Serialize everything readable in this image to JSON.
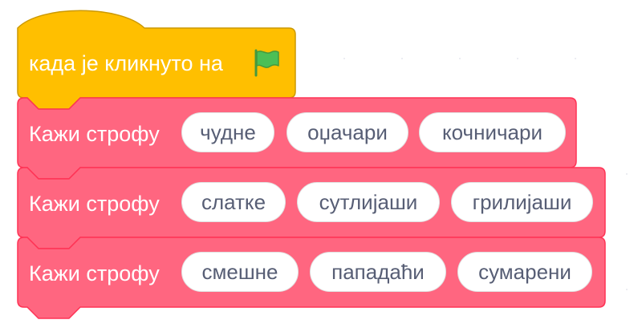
{
  "hat_block": {
    "label": "када је кликнуто на",
    "icon": "green-flag-icon",
    "color": "#ffbf00",
    "border_color": "#cc9900"
  },
  "say_blocks": [
    {
      "label": "Кажи строфу",
      "args": [
        "чудне",
        "оџачари",
        "кочничари"
      ]
    },
    {
      "label": "Кажи строфу",
      "args": [
        "слатке",
        "сутлијаши",
        "грилијаши"
      ]
    },
    {
      "label": "Кажи строфу",
      "args": [
        "смешне",
        "пападаћи",
        "сумарени"
      ]
    }
  ],
  "colors": {
    "say_block": "#ff6680",
    "say_block_border": "#ff3355",
    "pill_text": "#575e75",
    "flag": "#4cbf56",
    "flag_border": "#45993d"
  }
}
